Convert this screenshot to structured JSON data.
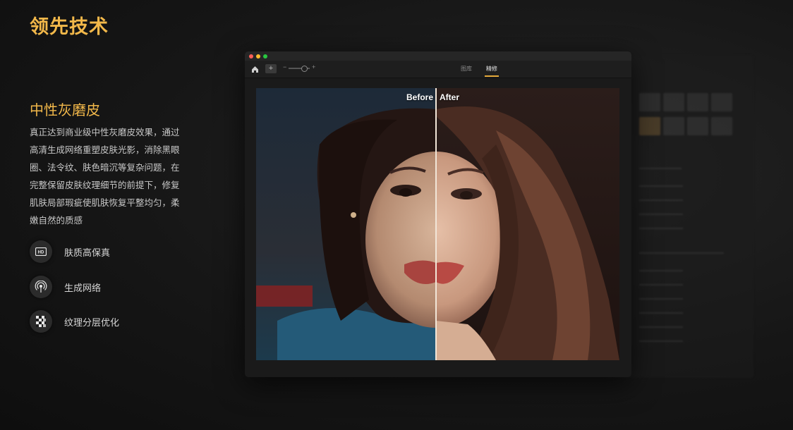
{
  "heading": "领先技术",
  "feature": {
    "title": "中性灰磨皮",
    "description": "真正达到商业级中性灰磨皮效果，通过高清生成网络重塑皮肤光影，消除黑眼圈、法令纹、肤色暗沉等复杂问题，在完整保留皮肤纹理细节的前提下，修复肌肤局部瑕疵使肌肤恢复平整均匀，柔嫩自然的质感"
  },
  "bullets": [
    {
      "icon": "hd-icon",
      "label": "肤质高保真"
    },
    {
      "icon": "network-icon",
      "label": "生成网络"
    },
    {
      "icon": "layers-icon",
      "label": "纹理分层优化"
    }
  ],
  "app": {
    "tabs": [
      "图库",
      "精修"
    ],
    "active_tab": "精修",
    "compare": {
      "before_label": "Before",
      "after_label": "After"
    }
  },
  "colors": {
    "accent": "#f2b84a",
    "tab_underline": "#e3a83a",
    "window_bg": "#1a1a1a",
    "page_bg": "#141414"
  }
}
